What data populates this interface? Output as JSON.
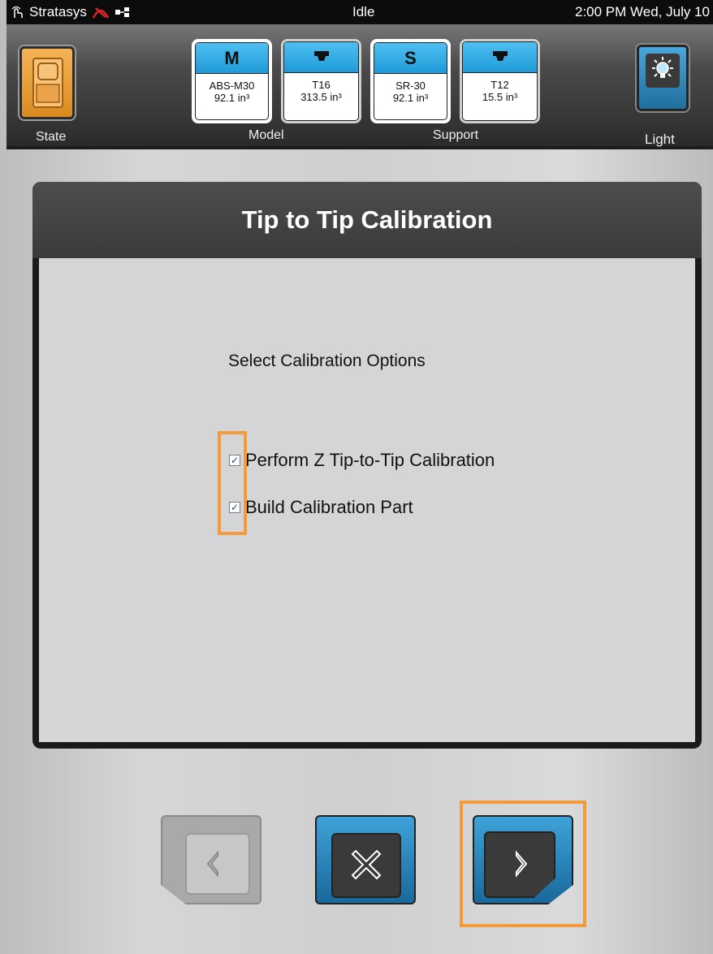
{
  "status_bar": {
    "brand": "Stratasys",
    "state": "Idle",
    "datetime": "2:00 PM Wed, July 10",
    "icons": [
      "touch-icon",
      "alert-icon",
      "network-icon"
    ]
  },
  "header": {
    "state_label": "State",
    "light_label": "Light",
    "model_label": "Model",
    "support_label": "Support",
    "materials": [
      {
        "badge": "M",
        "name": "ABS-M30",
        "volume": "92.1 in³"
      },
      {
        "badge": "tip-icon",
        "name": "T16",
        "volume": "313.5 in³"
      },
      {
        "badge": "S",
        "name": "SR-30",
        "volume": "92.1 in³"
      },
      {
        "badge": "tip-icon",
        "name": "T12",
        "volume": "15.5 in³"
      }
    ]
  },
  "panel": {
    "title": "Tip to Tip Calibration",
    "subtitle": "Select Calibration Options",
    "options": [
      {
        "label": "Perform Z Tip-to-Tip Calibration",
        "checked": true
      },
      {
        "label": "Build Calibration Part",
        "checked": true
      }
    ]
  },
  "nav": {
    "back": {
      "icon": "chevron-left-icon",
      "enabled": false
    },
    "cancel": {
      "icon": "close-icon",
      "enabled": true
    },
    "next": {
      "icon": "chevron-right-icon",
      "enabled": true
    }
  },
  "colors": {
    "accent_blue": "#2a8fcc",
    "state_orange": "#e89a2e",
    "highlight_orange": "#f39b3a"
  }
}
